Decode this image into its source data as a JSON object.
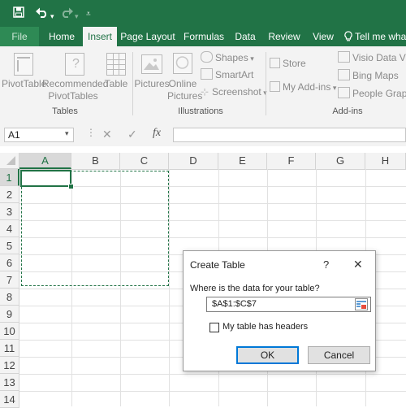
{
  "title_bar": {
    "save_icon": "save-icon",
    "undo_icon": "undo-icon",
    "redo_icon": "redo-icon",
    "customize_icon": "customize-qat-icon"
  },
  "tabs": [
    {
      "label": "File"
    },
    {
      "label": "Home"
    },
    {
      "label": "Insert"
    },
    {
      "label": "Page Layout"
    },
    {
      "label": "Formulas"
    },
    {
      "label": "Data"
    },
    {
      "label": "Review"
    },
    {
      "label": "View"
    }
  ],
  "tell_me": "Tell me what",
  "ribbon": {
    "tables": {
      "pivot": "PivotTable",
      "recommended_1": "Recommended",
      "recommended_2": "PivotTables",
      "table": "Table",
      "group": "Tables"
    },
    "illustrations": {
      "pictures": "Pictures",
      "online_1": "Online",
      "online_2": "Pictures",
      "shapes": "Shapes",
      "smartart": "SmartArt",
      "screenshot": "Screenshot",
      "group": "Illustrations"
    },
    "addins": {
      "store": "Store",
      "myaddins": "My Add-ins",
      "visio": "Visio Data Visu",
      "bing": "Bing Maps",
      "people": "People Graph",
      "group": "Add-ins"
    }
  },
  "formula_bar": {
    "name_box": "A1",
    "cancel": "✕",
    "enter": "✓",
    "fx": "fx",
    "value": ""
  },
  "grid": {
    "columns": [
      "A",
      "B",
      "C",
      "D",
      "E",
      "F",
      "G",
      "H"
    ],
    "rows": [
      "1",
      "2",
      "3",
      "4",
      "5",
      "6",
      "7",
      "8",
      "9",
      "10",
      "11",
      "12",
      "13",
      "14"
    ],
    "selected_cell": "A1"
  },
  "dialog": {
    "title": "Create Table",
    "help": "?",
    "close": "✕",
    "prompt": "Where is the data for your table?",
    "range_value": "$A$1:$C$7",
    "checkbox_label": "My table has headers",
    "checkbox_checked": false,
    "ok": "OK",
    "cancel": "Cancel"
  },
  "colors": {
    "accent": "#217346",
    "ribbon_bg": "#f3f3f3",
    "focus": "#0078d7"
  }
}
